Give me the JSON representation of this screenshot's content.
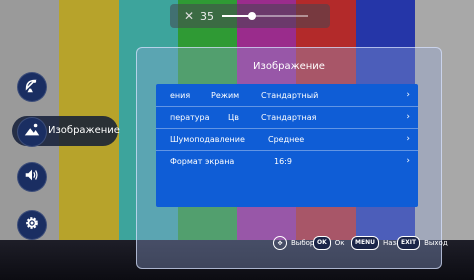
{
  "background": {
    "bar_colors": [
      "#9a9a9a",
      "#b7a32b",
      "#3da49c",
      "#2f9a34",
      "#9a2c8c",
      "#b32a2a",
      "#2536a8",
      "#a8a8a8"
    ]
  },
  "top_indicator": {
    "icon": "brightness-icon",
    "value": "35",
    "level": 0.35
  },
  "sidebar": {
    "items": [
      {
        "icon": "satellite-dish-icon",
        "label": ""
      },
      {
        "icon": "picture-icon",
        "label": "Изображение",
        "active": true
      },
      {
        "icon": "speaker-icon",
        "label": ""
      },
      {
        "icon": "gear-icon",
        "label": ""
      }
    ]
  },
  "panel": {
    "title": "Изображение",
    "rows": [
      {
        "label": "ения",
        "sublabel": "Режим",
        "value": "Стандартный",
        "arrow": "›"
      },
      {
        "label": "пература",
        "sublabel": "Цв",
        "value": "Стандартная",
        "arrow": "›"
      },
      {
        "label": "Шумоподавление",
        "sublabel": "",
        "value": "Среднее",
        "arrow": "›"
      },
      {
        "label": "Формат экрана",
        "sublabel": "",
        "value": "16:9",
        "arrow": "›"
      }
    ]
  },
  "hints": {
    "select_label": "Выбор",
    "ok_badge": "OK",
    "ok_label": "Ок",
    "menu_badge": "MENU",
    "back_label": "Назад",
    "exit_badge": "EXIT",
    "exit_label": "Выход"
  },
  "colors": {
    "accent": "#0f5dd6",
    "icon_circle": "#1a2e62"
  }
}
